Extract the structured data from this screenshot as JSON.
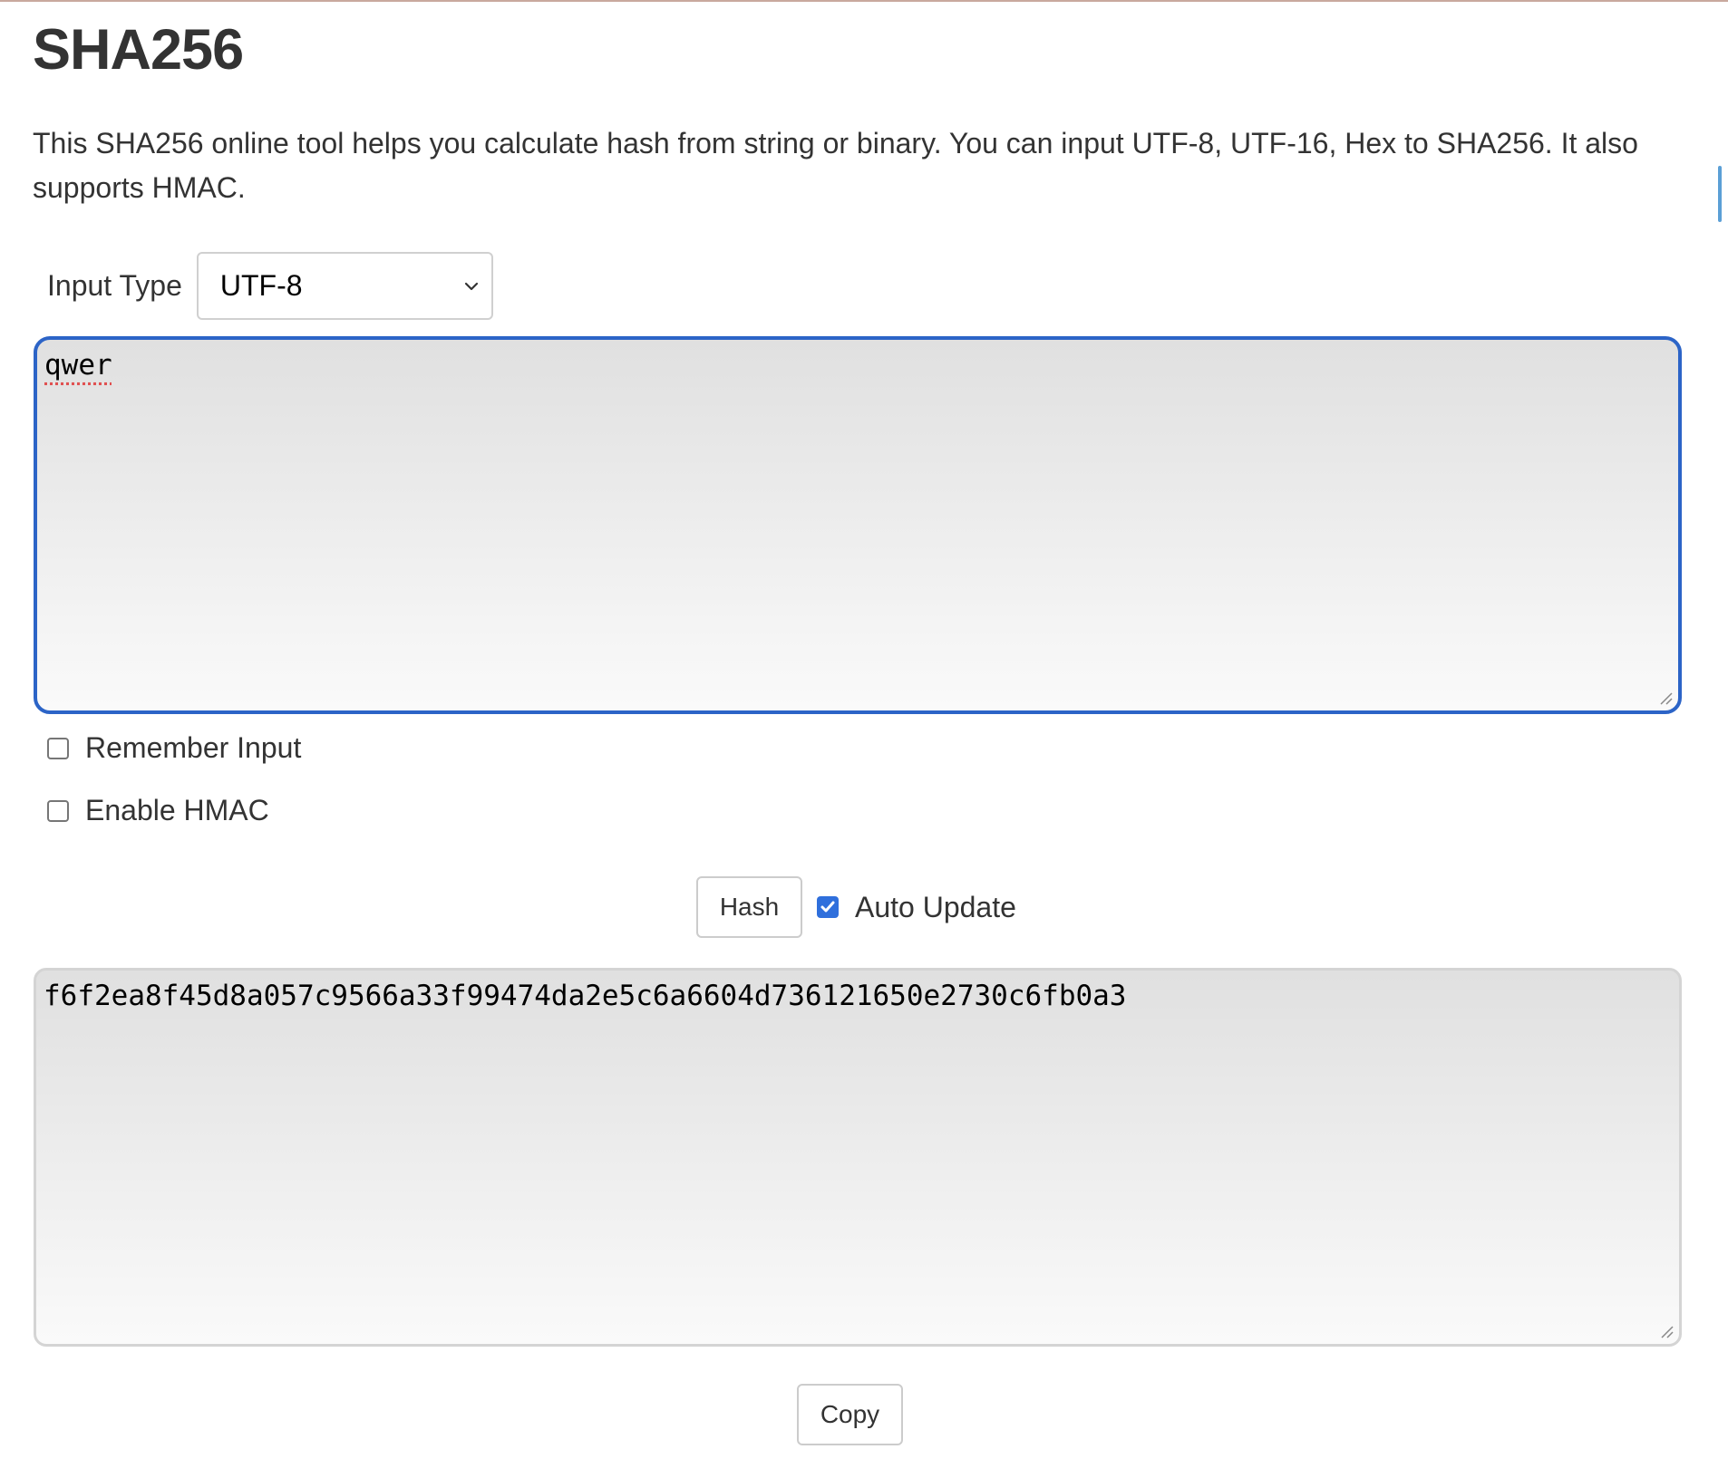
{
  "page": {
    "title": "SHA256",
    "description": "This SHA256 online tool helps you calculate hash from string or binary. You can input UTF-8, UTF-16, Hex to SHA256. It also supports HMAC."
  },
  "input_type": {
    "label": "Input Type",
    "selected": "UTF-8"
  },
  "input": {
    "value": "qwer"
  },
  "options": {
    "remember_input": {
      "label": "Remember Input",
      "checked": false
    },
    "enable_hmac": {
      "label": "Enable HMAC",
      "checked": false
    }
  },
  "controls": {
    "hash_label": "Hash",
    "auto_update_label": "Auto Update",
    "auto_update_checked": true
  },
  "output": {
    "value": "f6f2ea8f45d8a057c9566a33f99474da2e5c6a6604d736121650e2730c6fb0a3"
  },
  "copy_label": "Copy",
  "colors": {
    "focus_border": "#2c64c7",
    "checkbox_checked": "#2f6fdc",
    "heading": "#333333"
  },
  "icons": [
    "chevron-down-icon",
    "checkmark-icon",
    "resize-grip-icon"
  ]
}
